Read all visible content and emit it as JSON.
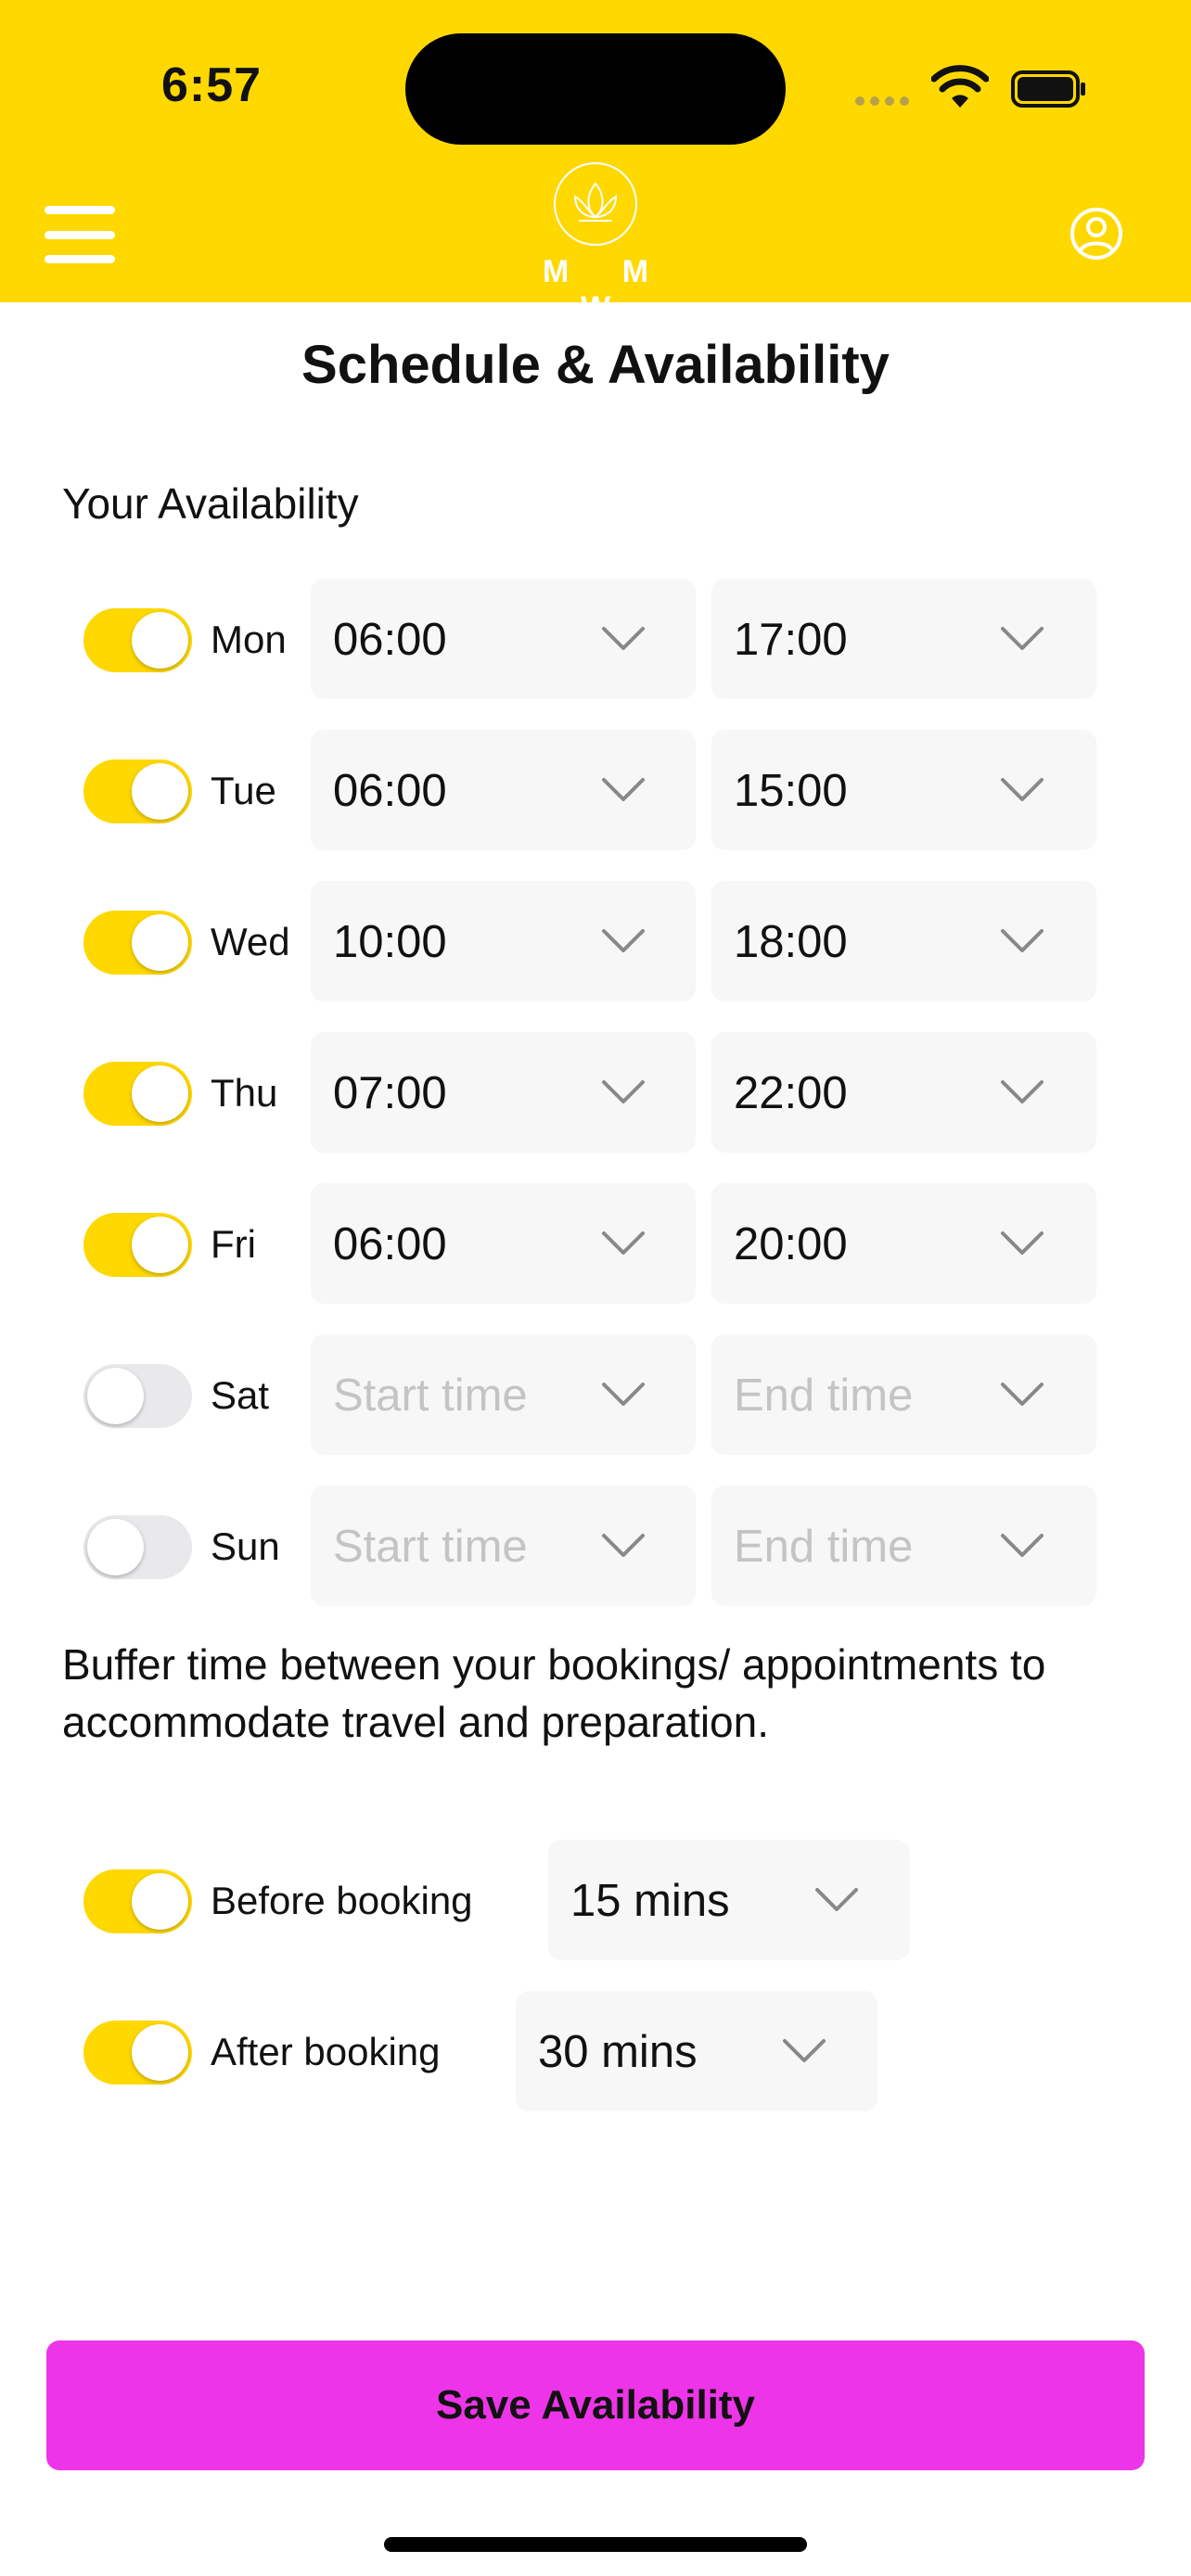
{
  "status_bar": {
    "time": "6:57"
  },
  "header": {
    "logo_text": "M M W",
    "icons": {
      "menu": "hamburger-menu-icon",
      "profile": "user-profile-icon",
      "logo": "lotus-icon"
    },
    "colors": {
      "background": "#FFD800"
    }
  },
  "page": {
    "title": "Schedule & Availability"
  },
  "availability": {
    "section_title": "Your Availability",
    "days": [
      {
        "label": "Mon",
        "enabled": true,
        "start": "06:00",
        "end": "17:00"
      },
      {
        "label": "Tue",
        "enabled": true,
        "start": "06:00",
        "end": "15:00"
      },
      {
        "label": "Wed",
        "enabled": true,
        "start": "10:00",
        "end": "18:00"
      },
      {
        "label": "Thu",
        "enabled": true,
        "start": "07:00",
        "end": "22:00"
      },
      {
        "label": "Fri",
        "enabled": true,
        "start": "06:00",
        "end": "20:00"
      },
      {
        "label": "Sat",
        "enabled": false,
        "start": "Start time",
        "end": "End time"
      },
      {
        "label": "Sun",
        "enabled": false,
        "start": "Start time",
        "end": "End time"
      }
    ]
  },
  "buffer": {
    "description": "Buffer time between your bookings/ appointments to accommodate travel and preparation.",
    "before": {
      "label": "Before booking",
      "enabled": true,
      "value": "15 mins"
    },
    "after": {
      "label": "After booking",
      "enabled": true,
      "value": "30 mins"
    }
  },
  "actions": {
    "save_label": "Save Availability",
    "save_color": "#EE34E8"
  }
}
